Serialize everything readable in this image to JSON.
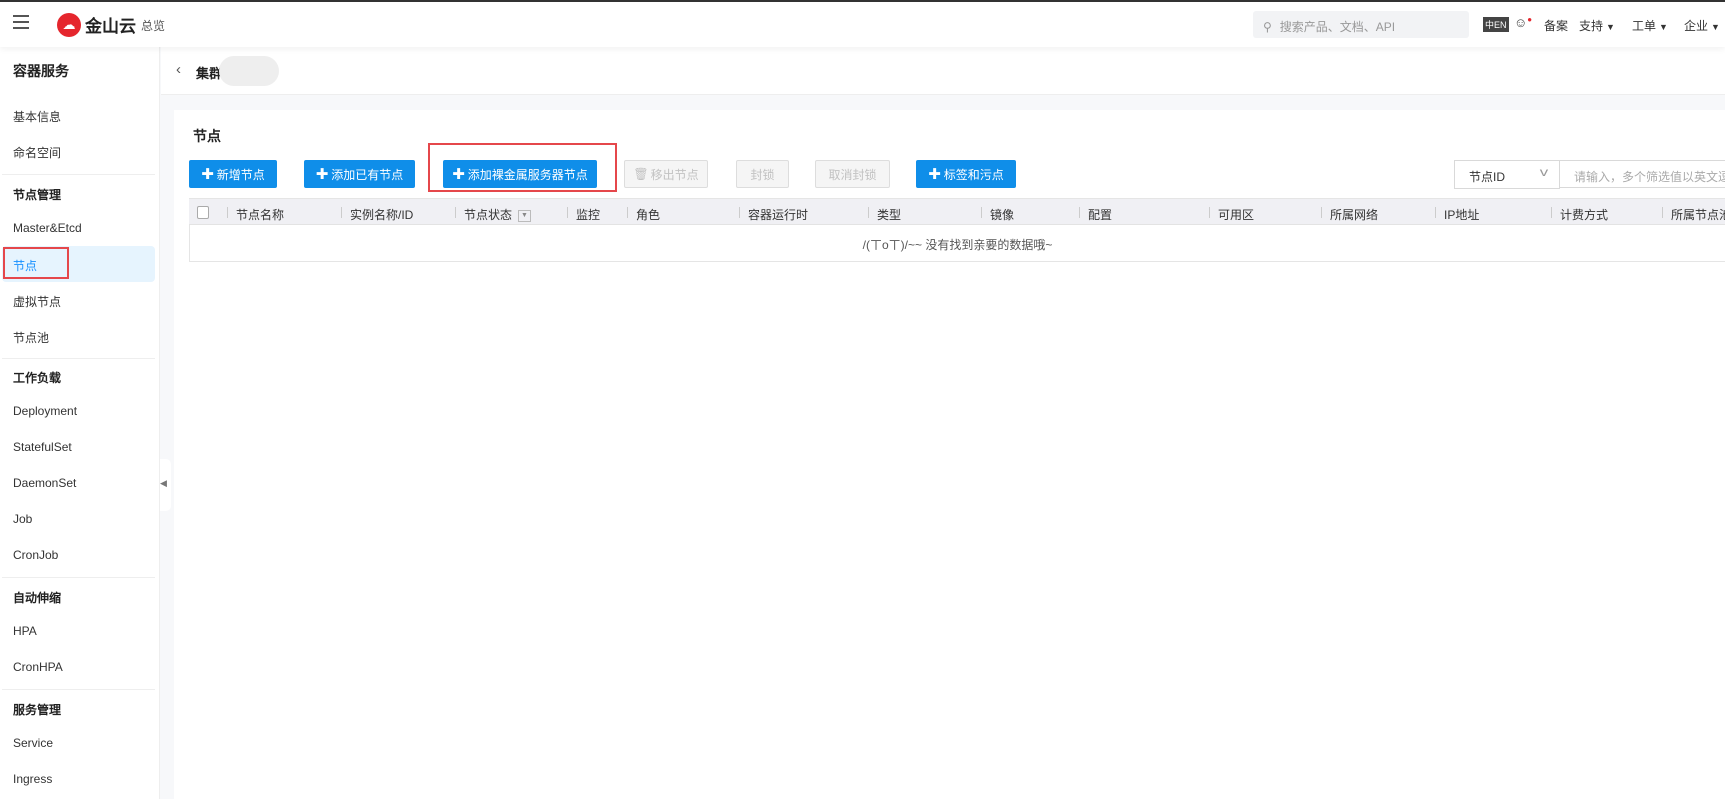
{
  "header": {
    "brand": "金山云",
    "overview": "总览",
    "search_placeholder": "搜索产品、文档、API",
    "lang_icon": "中EN",
    "links": [
      "备案",
      "支持",
      "工单",
      "企业"
    ]
  },
  "sidebar": {
    "title": "容器服务",
    "items": [
      {
        "label": "基本信息"
      },
      {
        "label": "命名空间"
      },
      {
        "label": "节点管理",
        "group": true
      },
      {
        "label": "Master&Etcd"
      },
      {
        "label": "节点",
        "active": true
      },
      {
        "label": "虚拟节点"
      },
      {
        "label": "节点池"
      },
      {
        "label": "工作负载",
        "group": true
      },
      {
        "label": "Deployment"
      },
      {
        "label": "StatefulSet"
      },
      {
        "label": "DaemonSet"
      },
      {
        "label": "Job"
      },
      {
        "label": "CronJob"
      },
      {
        "label": "自动伸缩",
        "group": true
      },
      {
        "label": "HPA"
      },
      {
        "label": "CronHPA"
      },
      {
        "label": "服务管理",
        "group": true
      },
      {
        "label": "Service"
      },
      {
        "label": "Ingress"
      }
    ]
  },
  "breadcrumb": {
    "title": "集群"
  },
  "main": {
    "title": "节点",
    "buttons": [
      "新增节点",
      "添加已有节点",
      "添加裸金属服务器节点",
      "移出节点",
      "封锁",
      "取消封锁",
      "标签和污点"
    ],
    "filter": {
      "select": "节点ID",
      "placeholder": "请输入，多个筛选值以英文逗号"
    },
    "columns": [
      "节点名称",
      "实例名称/ID",
      "节点状态",
      "监控",
      "角色",
      "容器运行时",
      "类型",
      "镜像",
      "配置",
      "可用区",
      "所属网络",
      "IP地址",
      "计费方式",
      "所属节点池"
    ],
    "empty_text": "/(ㄒoㄒ)/~~ 没有找到亲要的数据哦~"
  },
  "colors": {
    "primary": "#0f8ee9",
    "highlight": "#e5474b",
    "brand": "#e5262d"
  }
}
